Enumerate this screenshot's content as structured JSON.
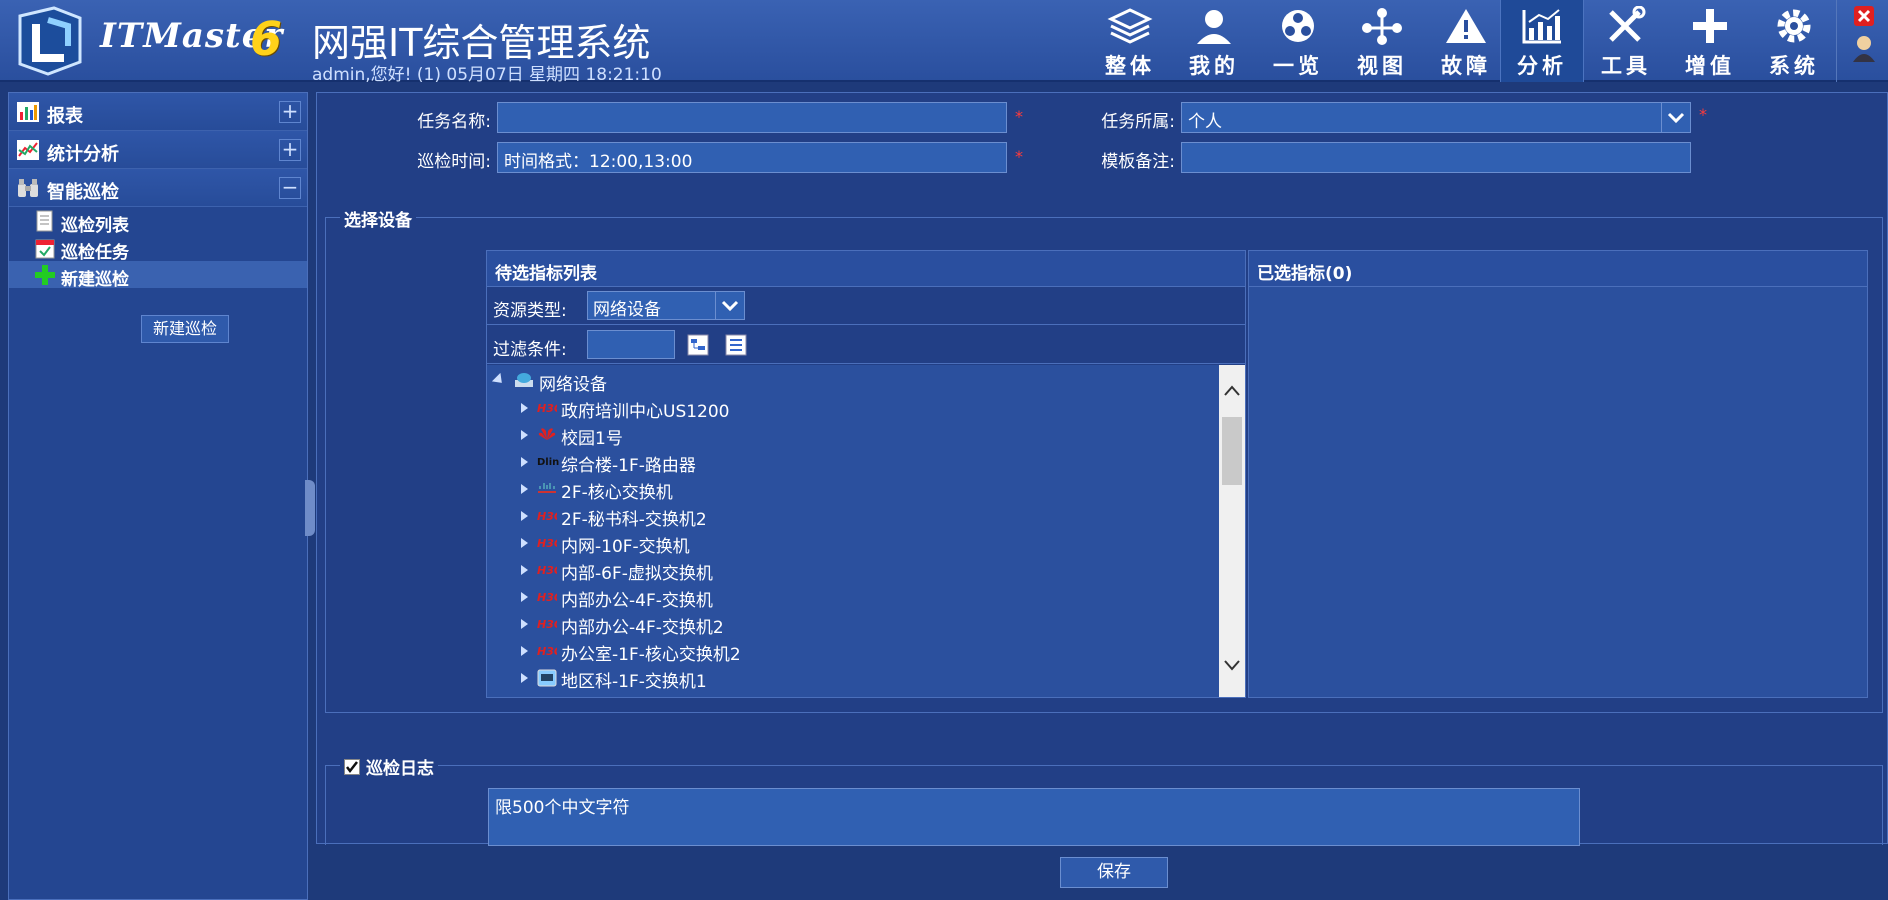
{
  "header": {
    "brand": "ITMaster",
    "brand_num": "6",
    "title": "网强IT综合管理系统",
    "subtitle": "admin,您好! (1) 05月07日 星期四 18:21:10",
    "nav": [
      {
        "label": "整体",
        "icon": "layers-icon"
      },
      {
        "label": "我的",
        "icon": "user-icon"
      },
      {
        "label": "一览",
        "icon": "overview-icon"
      },
      {
        "label": "视图",
        "icon": "topology-icon"
      },
      {
        "label": "故障",
        "icon": "warning-icon"
      },
      {
        "label": "分析",
        "icon": "analysis-chart-icon",
        "active": true
      },
      {
        "label": "工具",
        "icon": "tools-icon"
      },
      {
        "label": "增值",
        "icon": "plus-icon"
      },
      {
        "label": "系统",
        "icon": "gear-icon"
      }
    ]
  },
  "sidebar": {
    "sections": [
      {
        "label": "报表",
        "toggle": "+"
      },
      {
        "label": "统计分析",
        "toggle": "+"
      },
      {
        "label": "智能巡检",
        "toggle": "−"
      }
    ],
    "items": [
      {
        "label": "巡检列表"
      },
      {
        "label": "巡检任务"
      },
      {
        "label": "新建巡检",
        "active": true
      }
    ],
    "button": "新建巡检"
  },
  "form": {
    "task_name_label": "任务名称:",
    "task_name_value": "",
    "inspect_time_label": "巡检时间:",
    "inspect_time_placeholder": "时间格式：12:00,13:00",
    "owner_label": "任务所属:",
    "owner_value": "个人",
    "remark_label": "模板备注:",
    "remark_value": "",
    "required_mark": "*"
  },
  "select_device": {
    "legend": "选择设备",
    "left_title": "待选指标列表",
    "right_title": "已选指标(0)",
    "resource_type_label": "资源类型:",
    "resource_type_value": "网络设备",
    "filter_label": "过滤条件:",
    "filter_value": "",
    "tree_root": "网络设备",
    "tree_items": [
      {
        "label": "政府培训中心US1200",
        "icon": "h3c"
      },
      {
        "label": "校园1号",
        "icon": "huawei"
      },
      {
        "label": "综合楼-1F-路由器",
        "icon": "dlink"
      },
      {
        "label": "2F-核心交换机",
        "icon": "cisco"
      },
      {
        "label": "2F-秘书科-交换机2",
        "icon": "h3c"
      },
      {
        "label": "内网-10F-交换机",
        "icon": "h3c"
      },
      {
        "label": "内部-6F-虚拟交换机",
        "icon": "h3c"
      },
      {
        "label": "内部办公-4F-交换机",
        "icon": "h3c"
      },
      {
        "label": "内部办公-4F-交换机2",
        "icon": "h3c"
      },
      {
        "label": "办公室-1F-核心交换机2",
        "icon": "h3c"
      },
      {
        "label": "地区科-1F-交换机1",
        "icon": "generic"
      }
    ]
  },
  "log": {
    "legend": "巡检日志",
    "checked": true,
    "placeholder": "限500个中文字符"
  },
  "save_button": "保存"
}
